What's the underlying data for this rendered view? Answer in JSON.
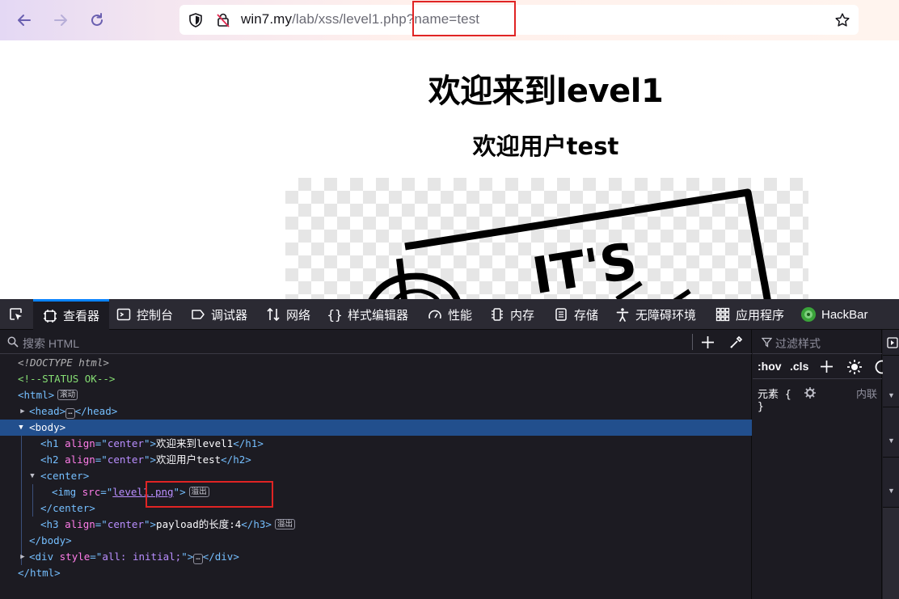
{
  "browser": {
    "url_host": "win7.my",
    "url_path": "/lab/xss/level1.php?name=test",
    "back_icon": "arrow-left-icon",
    "forward_icon": "arrow-right-icon",
    "reload_icon": "reload-icon",
    "bookmark_icon": "star-icon"
  },
  "page": {
    "h1": "欢迎来到level1",
    "h2": "欢迎用户test",
    "image_text": "IT'S"
  },
  "devtools": {
    "tabs": [
      {
        "label": "查看器",
        "icon": "inspector-icon"
      },
      {
        "label": "控制台",
        "icon": "console-icon"
      },
      {
        "label": "调试器",
        "icon": "debugger-icon"
      },
      {
        "label": "网络",
        "icon": "network-icon"
      },
      {
        "label": "样式编辑器",
        "icon": "style-editor-icon"
      },
      {
        "label": "性能",
        "icon": "performance-icon"
      },
      {
        "label": "内存",
        "icon": "memory-icon"
      },
      {
        "label": "存储",
        "icon": "storage-icon"
      },
      {
        "label": "无障碍环境",
        "icon": "accessibility-icon"
      },
      {
        "label": "应用程序",
        "icon": "application-icon"
      },
      {
        "label": "HackBar",
        "icon": "hackbar-icon"
      }
    ],
    "search_placeholder": "搜索 HTML",
    "filter_placeholder": "过滤样式",
    "hov_label": ":hov",
    "cls_label": ".cls",
    "element_rule": "元素 {",
    "element_rule_close": "}",
    "inline_label": "内联",
    "badge_scroll": "滚动",
    "badge_overflow": "溢出",
    "tree": {
      "doctype": "<!DOCTYPE html>",
      "comment": "<!--STATUS OK-->",
      "html_open": "<html>",
      "head_open": "<head>",
      "head_close": "</head>",
      "body_open": "<body>",
      "h1_tag": "h1",
      "h2_tag": "h2",
      "h3_tag": "h3",
      "attr_align": "align",
      "val_center": "center",
      "h1_text": "欢迎来到level1",
      "h2_text": "欢迎用户test",
      "center_tag": "center",
      "img_tag": "img",
      "attr_src": "src",
      "val_src": "level1.png",
      "h3_text": "payload的长度:4",
      "div_tag": "div",
      "attr_style": "style",
      "val_style": "all: initial;",
      "html_close": "</html>"
    }
  }
}
